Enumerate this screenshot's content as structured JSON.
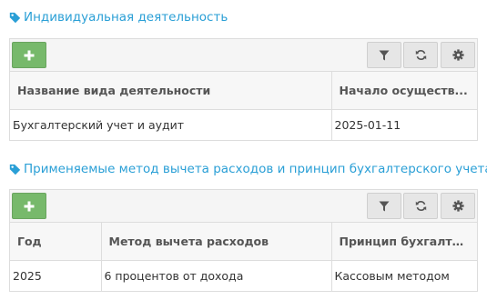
{
  "colors": {
    "accent": "#2a9fd6",
    "add_button": "#77b96b"
  },
  "section1": {
    "title": "Индивидуальная деятельность",
    "table": {
      "headers": [
        "Название вида деятельности",
        "Начало осуществ..."
      ],
      "rows": [
        [
          "Бухгалтерский учет и аудит",
          "2025-01-11"
        ]
      ]
    }
  },
  "section2": {
    "title": "Применяемые метод вычета расходов и принцип бухгалтерского учета",
    "table": {
      "headers": [
        "Год",
        "Метод вычета расходов",
        "Принцип бухгалтер..."
      ],
      "rows": [
        [
          "2025",
          "6 процентов от дохода",
          "Кассовым методом"
        ]
      ]
    }
  },
  "icons": {
    "tag": "tag-icon",
    "add": "plus-icon",
    "filter": "filter-icon",
    "refresh": "refresh-icon",
    "settings": "gear-icon"
  }
}
